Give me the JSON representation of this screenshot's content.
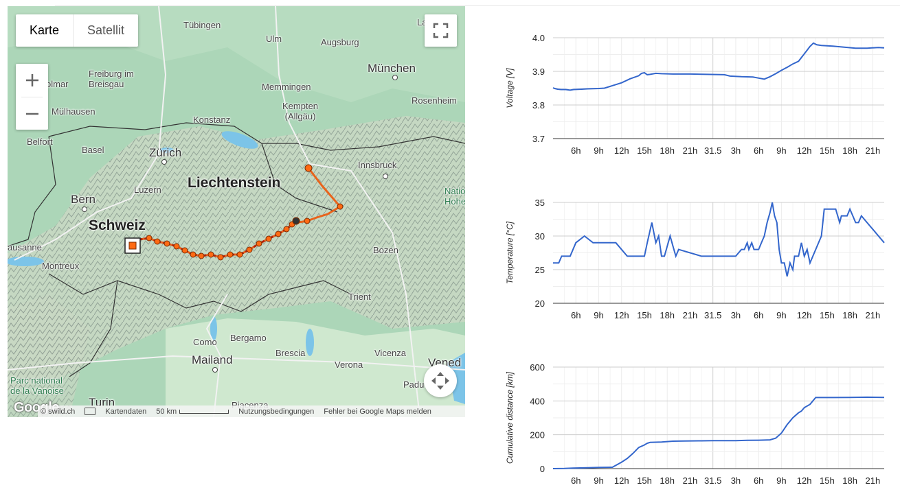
{
  "map": {
    "maptype": {
      "map_label": "Karte",
      "satellite_label": "Satellit"
    },
    "icons": {
      "fullscreen": "fullscreen-icon",
      "zoom_in": "plus-icon",
      "zoom_out": "minus-icon",
      "camera": "move-arrows-icon",
      "keyboard": "keyboard-icon"
    },
    "places": [
      {
        "id": "tuebingen",
        "label": "Tübingen"
      },
      {
        "id": "ulm",
        "label": "Ulm"
      },
      {
        "id": "augsburg",
        "label": "Augsburg"
      },
      {
        "id": "muenchen",
        "label": "München"
      },
      {
        "id": "freiburg",
        "label": "Freiburg im\nBreisgau"
      },
      {
        "id": "memmingen",
        "label": "Memmingen"
      },
      {
        "id": "kempten",
        "label": "Kempten\n(Allgäu)"
      },
      {
        "id": "rosenheim",
        "label": "Rosenheim"
      },
      {
        "id": "colmar",
        "label": "olmar"
      },
      {
        "id": "muelhausen",
        "label": "Mülhausen"
      },
      {
        "id": "konstanz",
        "label": "Konstanz"
      },
      {
        "id": "belfort",
        "label": "Belfort"
      },
      {
        "id": "basel",
        "label": "Basel"
      },
      {
        "id": "zuerich",
        "label": "Zürich"
      },
      {
        "id": "innsbruck",
        "label": "Innsbruck"
      },
      {
        "id": "luzern",
        "label": "Luzern"
      },
      {
        "id": "liechtenstein",
        "label": "Liechtenstein"
      },
      {
        "id": "bern",
        "label": "Bern"
      },
      {
        "id": "schweiz",
        "label": "Schweiz"
      },
      {
        "id": "lausanne",
        "label": "ausanne"
      },
      {
        "id": "montreux",
        "label": "Montreux"
      },
      {
        "id": "bozen",
        "label": "Bozen"
      },
      {
        "id": "trient",
        "label": "Trient"
      },
      {
        "id": "como",
        "label": "Como"
      },
      {
        "id": "bergamo",
        "label": "Bergamo"
      },
      {
        "id": "mailand",
        "label": "Mailand"
      },
      {
        "id": "brescia",
        "label": "Brescia"
      },
      {
        "id": "verona",
        "label": "Verona"
      },
      {
        "id": "vicenza",
        "label": "Vicenza"
      },
      {
        "id": "venedig",
        "label": "Vened"
      },
      {
        "id": "padua",
        "label": "Padu"
      },
      {
        "id": "vanoise",
        "label": "Parc national\nde la Vanoise"
      },
      {
        "id": "turin",
        "label": "Turin"
      },
      {
        "id": "piacenza",
        "label": "Piacenza"
      },
      {
        "id": "nationalpark",
        "label": "Natio\nHohe"
      },
      {
        "id": "landshut",
        "label": "La"
      }
    ],
    "attribution": {
      "swild": "© swild.ch",
      "map_data": "Kartendaten",
      "scale": "50 km",
      "terms": "Nutzungsbedingungen",
      "report": "Fehler bei Google Maps melden"
    },
    "logo_text": "Google",
    "track_color": "#e8641c",
    "marker_color": "#ff6a13"
  },
  "charts": {
    "x_ticks": [
      "6h",
      "9h",
      "12h",
      "15h",
      "18h",
      "21h",
      "31.5",
      "3h",
      "6h",
      "9h",
      "12h",
      "15h",
      "18h",
      "21h"
    ],
    "line_color": "#3366cc",
    "items": [
      {
        "id": "voltage",
        "ylabel": "Voltage [V]",
        "ylim": [
          3.7,
          4.0
        ],
        "yticks": [
          "3.7",
          "3.8",
          "3.9",
          "4.0"
        ],
        "points": [
          [
            0,
            3.851
          ],
          [
            0.3,
            3.849
          ],
          [
            0.8,
            3.847
          ],
          [
            1.4,
            3.846
          ],
          [
            2.2,
            3.846
          ],
          [
            3,
            3.844
          ],
          [
            3.6,
            3.846
          ],
          [
            5,
            3.847
          ],
          [
            6,
            3.848
          ],
          [
            8,
            3.849
          ],
          [
            9,
            3.85
          ],
          [
            10.5,
            3.858
          ],
          [
            12,
            3.866
          ],
          [
            13.5,
            3.878
          ],
          [
            15,
            3.887
          ],
          [
            15.5,
            3.894
          ],
          [
            16,
            3.896
          ],
          [
            16.5,
            3.89
          ],
          [
            17,
            3.891
          ],
          [
            18,
            3.894
          ],
          [
            19,
            3.893
          ],
          [
            21,
            3.892
          ],
          [
            24,
            3.892
          ],
          [
            27,
            3.891
          ],
          [
            30,
            3.89
          ],
          [
            31,
            3.886
          ],
          [
            33,
            3.884
          ],
          [
            35,
            3.883
          ],
          [
            36,
            3.88
          ],
          [
            37,
            3.877
          ],
          [
            38,
            3.884
          ],
          [
            39,
            3.893
          ],
          [
            40,
            3.903
          ],
          [
            41,
            3.912
          ],
          [
            42,
            3.922
          ],
          [
            43,
            3.93
          ],
          [
            44,
            3.952
          ],
          [
            45,
            3.974
          ],
          [
            45.6,
            3.984
          ],
          [
            46.2,
            3.979
          ],
          [
            47,
            3.977
          ],
          [
            49,
            3.975
          ],
          [
            51,
            3.972
          ],
          [
            53,
            3.969
          ],
          [
            55,
            3.969
          ],
          [
            57,
            3.971
          ],
          [
            58,
            3.97
          ]
        ]
      },
      {
        "id": "temperature",
        "ylabel": "Temperature [°C]",
        "ylim": [
          20,
          35
        ],
        "yticks": [
          "20",
          "25",
          "30",
          "35"
        ],
        "points": [
          [
            0,
            26
          ],
          [
            1,
            26
          ],
          [
            1.5,
            27
          ],
          [
            3,
            27
          ],
          [
            4,
            29
          ],
          [
            5.5,
            30
          ],
          [
            7,
            29
          ],
          [
            8,
            29
          ],
          [
            9,
            29
          ],
          [
            11,
            29
          ],
          [
            13,
            27
          ],
          [
            16,
            27
          ],
          [
            16.5,
            29
          ],
          [
            17.3,
            32
          ],
          [
            18,
            29
          ],
          [
            18.5,
            30
          ],
          [
            19,
            27
          ],
          [
            19.5,
            27
          ],
          [
            20.5,
            30
          ],
          [
            21,
            28.5
          ],
          [
            21.5,
            27
          ],
          [
            22,
            28
          ],
          [
            26,
            27
          ],
          [
            32,
            27
          ],
          [
            33,
            28
          ],
          [
            33.5,
            28
          ],
          [
            34,
            29
          ],
          [
            34.3,
            28
          ],
          [
            34.8,
            29
          ],
          [
            35.2,
            28
          ],
          [
            36,
            28
          ],
          [
            36.5,
            29
          ],
          [
            37,
            30
          ],
          [
            37.5,
            32
          ],
          [
            38,
            33.5
          ],
          [
            38.4,
            35
          ],
          [
            38.8,
            33
          ],
          [
            39.2,
            32
          ],
          [
            39.6,
            28
          ],
          [
            40,
            26
          ],
          [
            40.5,
            26
          ],
          [
            41,
            24
          ],
          [
            41.5,
            26
          ],
          [
            42,
            25
          ],
          [
            42.3,
            27
          ],
          [
            43,
            27
          ],
          [
            43.5,
            29
          ],
          [
            44,
            27
          ],
          [
            44.5,
            28
          ],
          [
            45,
            26
          ],
          [
            47,
            30
          ],
          [
            47.5,
            34
          ],
          [
            49,
            34
          ],
          [
            49.5,
            34
          ],
          [
            50.2,
            32
          ],
          [
            50.5,
            33
          ],
          [
            51,
            33
          ],
          [
            51.5,
            33
          ],
          [
            52,
            34
          ],
          [
            52.5,
            33
          ],
          [
            53,
            32
          ],
          [
            53.5,
            32
          ],
          [
            54,
            33
          ],
          [
            58,
            29
          ]
        ]
      },
      {
        "id": "distance",
        "ylabel": "Cumulative distance [km]",
        "ylim": [
          0,
          600
        ],
        "yticks": [
          "0",
          "200",
          "400",
          "600"
        ],
        "points": [
          [
            0,
            0
          ],
          [
            2,
            1
          ],
          [
            3.5,
            3
          ],
          [
            6,
            5
          ],
          [
            8,
            7
          ],
          [
            10.4,
            8
          ],
          [
            12,
            38
          ],
          [
            13,
            60
          ],
          [
            14,
            90
          ],
          [
            15,
            125
          ],
          [
            16,
            140
          ],
          [
            16.5,
            150
          ],
          [
            17,
            155
          ],
          [
            19,
            157
          ],
          [
            21,
            162
          ],
          [
            23,
            163
          ],
          [
            26,
            164
          ],
          [
            28,
            165
          ],
          [
            30,
            165
          ],
          [
            32,
            165
          ],
          [
            34,
            167
          ],
          [
            36,
            168
          ],
          [
            38,
            170
          ],
          [
            39,
            180
          ],
          [
            40,
            210
          ],
          [
            41,
            260
          ],
          [
            42,
            300
          ],
          [
            43,
            330
          ],
          [
            43.5,
            340
          ],
          [
            44,
            360
          ],
          [
            45,
            380
          ],
          [
            46,
            420
          ],
          [
            49,
            420
          ],
          [
            52,
            421
          ],
          [
            55,
            422
          ],
          [
            58,
            421
          ]
        ]
      }
    ]
  }
}
